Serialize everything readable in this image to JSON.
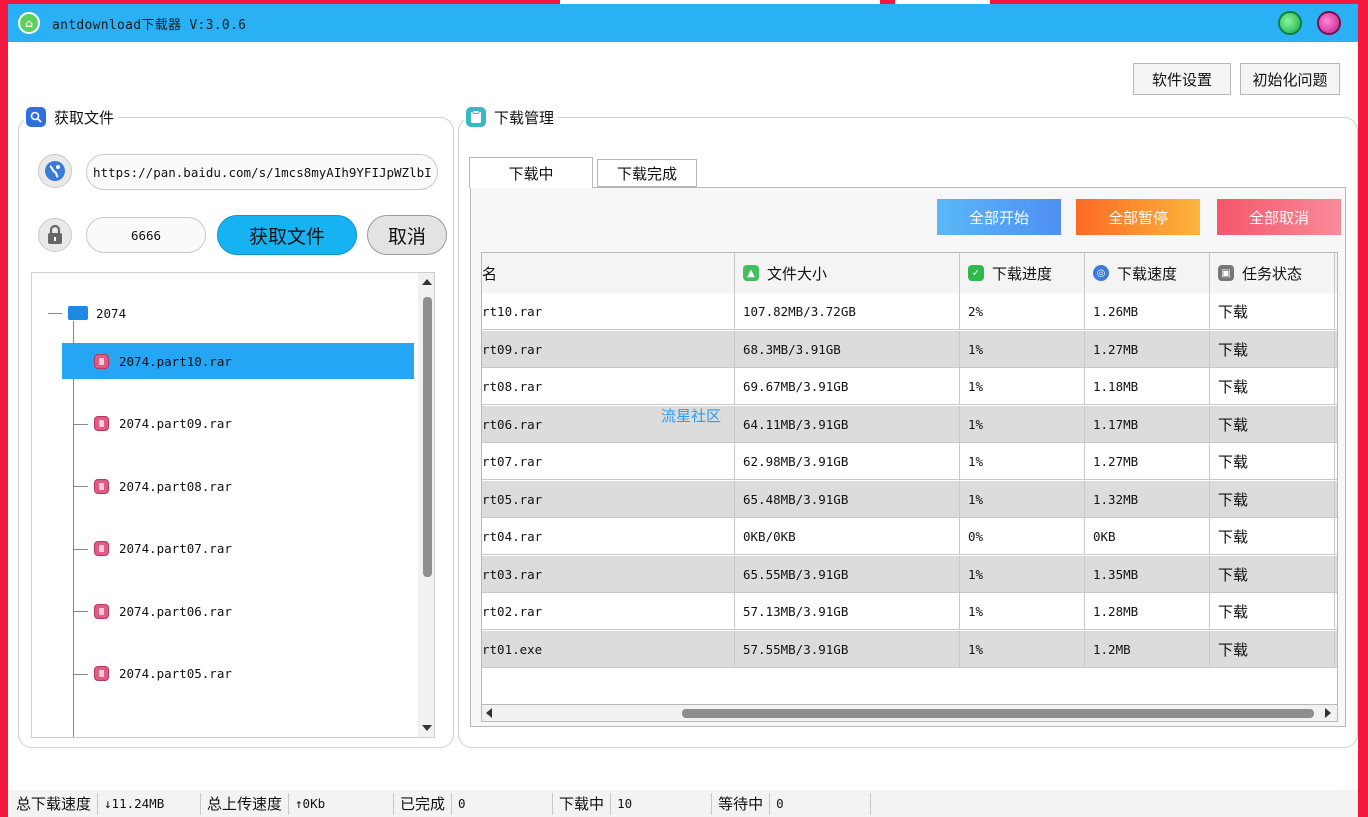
{
  "app": {
    "title": "antdownload下载器  V:3.0.6"
  },
  "toolbar": {
    "settings_label": "软件设置",
    "init_label": "初始化问题"
  },
  "fetch_panel": {
    "title": "获取文件",
    "url_value": "https://pan.baidu.com/s/1mcs8myAIh9YFIJpWZlbI",
    "password_value": "6666",
    "fetch_button": "获取文件",
    "cancel_button": "取消",
    "tree": {
      "root": "2074",
      "items": [
        "2074.part10.rar",
        "2074.part09.rar",
        "2074.part08.rar",
        "2074.part07.rar",
        "2074.part06.rar",
        "2074.part05.rar"
      ],
      "selected_index": 0
    }
  },
  "download_panel": {
    "title": "下载管理",
    "tabs": [
      "下载中",
      "下载完成"
    ],
    "active_tab": 0,
    "actions": {
      "start_all": "全部开始",
      "pause_all": "全部暂停",
      "cancel_all": "全部取消"
    },
    "columns": [
      "名",
      "文件大小",
      "下载进度",
      "下载速度",
      "任务状态"
    ],
    "rows": [
      [
        "rt10.rar",
        "107.82MB/3.72GB",
        "2%",
        "1.26MB",
        "下载"
      ],
      [
        "rt09.rar",
        "68.3MB/3.91GB",
        "1%",
        "1.27MB",
        "下载"
      ],
      [
        "rt08.rar",
        "69.67MB/3.91GB",
        "1%",
        "1.18MB",
        "下载"
      ],
      [
        "rt06.rar",
        "64.11MB/3.91GB",
        "1%",
        "1.17MB",
        "下载"
      ],
      [
        "rt07.rar",
        "62.98MB/3.91GB",
        "1%",
        "1.27MB",
        "下载"
      ],
      [
        "rt05.rar",
        "65.48MB/3.91GB",
        "1%",
        "1.32MB",
        "下载"
      ],
      [
        "rt04.rar",
        "0KB/0KB",
        "0%",
        "0KB",
        "下载"
      ],
      [
        "rt03.rar",
        "65.55MB/3.91GB",
        "1%",
        "1.35MB",
        "下载"
      ],
      [
        "rt02.rar",
        "57.13MB/3.91GB",
        "1%",
        "1.28MB",
        "下载"
      ],
      [
        "rt01.exe",
        "57.55MB/3.91GB",
        "1%",
        "1.2MB",
        "下载"
      ]
    ],
    "watermark": "流星社区"
  },
  "status_bar": {
    "total_download_label": "总下载速度",
    "total_download_value": "↓11.24MB",
    "total_upload_label": "总上传速度",
    "total_upload_value": "↑0Kb",
    "completed_label": "已完成",
    "completed_value": "0",
    "downloading_label": "下载中",
    "downloading_value": "10",
    "waiting_label": "等待中",
    "waiting_value": "0"
  },
  "colors": {
    "titlebar": "#2ab0f5",
    "accent": "#25a6f5",
    "fetch_button": "#16b3f3",
    "start_all": "#5aa8f5",
    "pause_all": "#fb7c26",
    "cancel_all": "#f55a6e",
    "backdrop": "#f2173d"
  }
}
